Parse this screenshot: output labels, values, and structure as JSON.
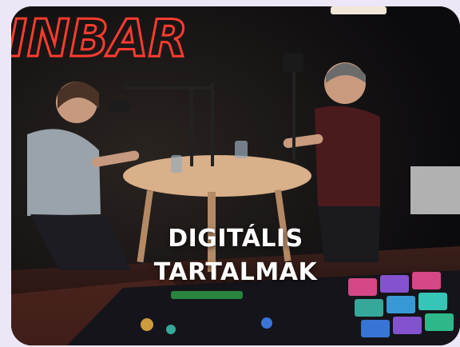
{
  "card": {
    "title_line1": "DIGITÁLIS",
    "title_line2": "TARTALMAK",
    "sign_text": "INBAR"
  },
  "colors": {
    "neon": "#ff3b2f",
    "background": "#0f0d12",
    "text": "#ffffff"
  }
}
